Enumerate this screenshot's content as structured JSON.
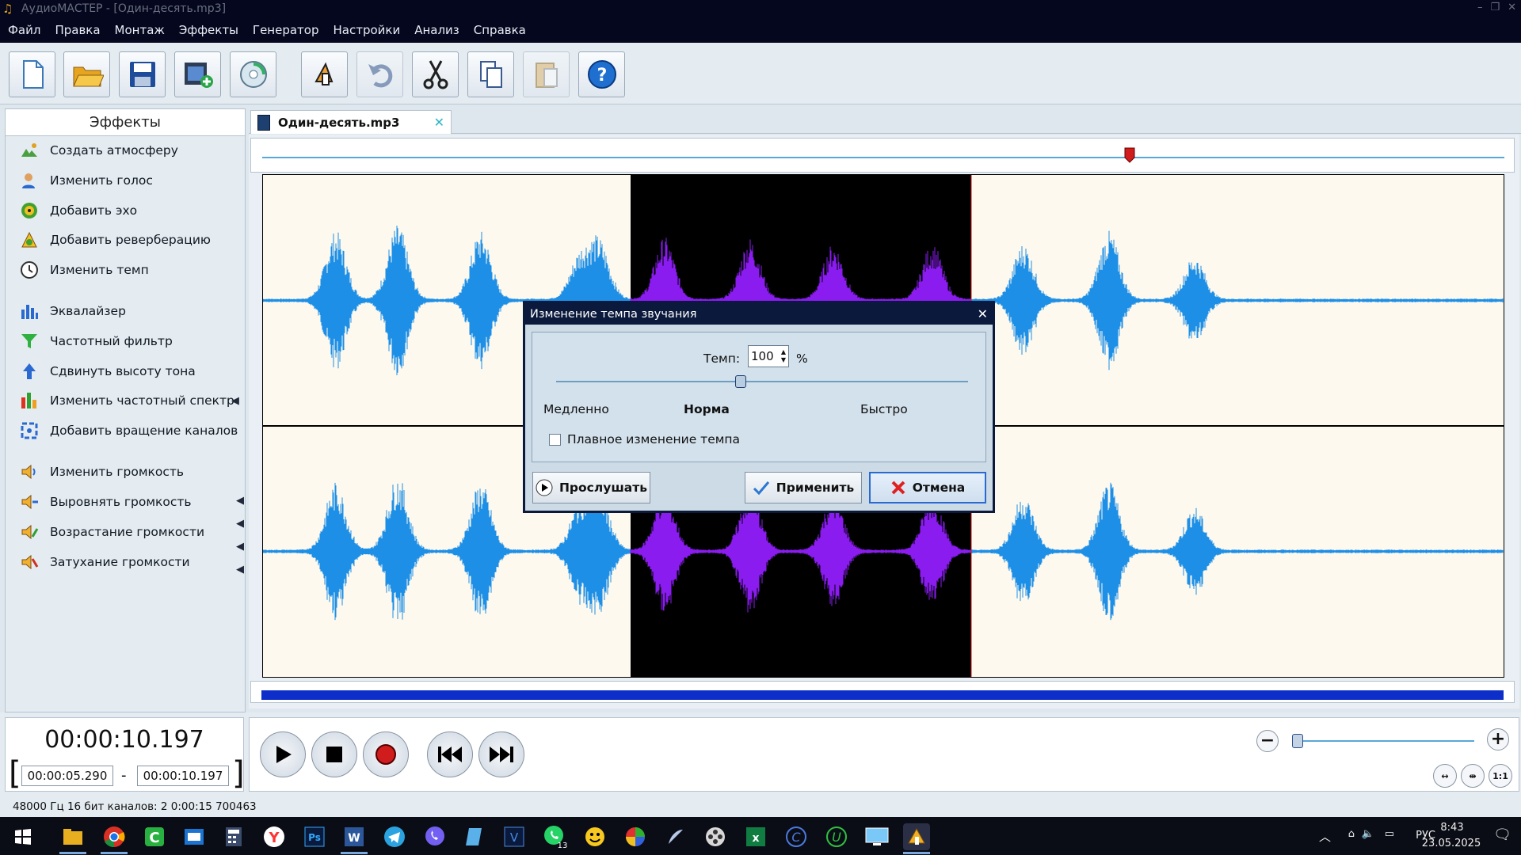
{
  "window": {
    "title": "АудиоМАСТЕР - [Один-десять.mp3]"
  },
  "menu": [
    "Файл",
    "Правка",
    "Монтаж",
    "Эффекты",
    "Генератор",
    "Настройки",
    "Анализ",
    "Справка"
  ],
  "toolbar": {
    "icons": [
      "new-file-icon",
      "open-folder-icon",
      "save-disk-icon",
      "add-video-icon",
      "cd-extract-icon",
      "voice-record-icon",
      "undo-icon",
      "scissors-icon",
      "copy-icon",
      "paste-icon",
      "help-icon"
    ]
  },
  "effects_panel": {
    "title": "Эффекты",
    "items": [
      {
        "label": "Создать атмосферу",
        "icon": "atmosphere-icon"
      },
      {
        "label": "Изменить голос",
        "icon": "voice-change-icon"
      },
      {
        "label": "Добавить эхо",
        "icon": "echo-icon"
      },
      {
        "label": "Добавить реверберацию",
        "icon": "reverb-icon"
      },
      {
        "label": "Изменить темп",
        "icon": "tempo-clock-icon"
      },
      {
        "label": "Эквалайзер",
        "icon": "equalizer-icon"
      },
      {
        "label": "Частотный фильтр",
        "icon": "frequency-filter-icon"
      },
      {
        "label": "Сдвинуть высоту тона",
        "icon": "pitch-shift-icon"
      },
      {
        "label": "Изменить частотный спектр",
        "icon": "spectrum-icon"
      },
      {
        "label": "Добавить вращение каналов",
        "icon": "channel-rotate-icon"
      },
      {
        "label": "Изменить громкость",
        "icon": "volume-icon"
      },
      {
        "label": "Выровнять громкость",
        "icon": "normalize-volume-icon"
      },
      {
        "label": "Возрастание громкости",
        "icon": "fade-in-icon"
      },
      {
        "label": "Затухание громкости",
        "icon": "fade-out-icon"
      }
    ]
  },
  "tab": {
    "label": "Один-десять.mp3"
  },
  "colors": {
    "waveform": "#1e8fe6",
    "selection_wave": "#8a1cf0",
    "selection_bg": "#000000",
    "accent": "#0d2ec9",
    "playhead": "#d01c1c"
  },
  "selection": {
    "start": "00:00:05.290",
    "end": "00:00:10.197"
  },
  "current_time": "00:00:10.197",
  "dialog": {
    "title": "Изменение темпа звучания",
    "tempo_label": "Темп:",
    "tempo_value": "100",
    "tempo_unit": "%",
    "slow": "Медленно",
    "normal": "Норма",
    "fast": "Быстро",
    "smooth_label": "Плавное изменение темпа",
    "smooth_checked": false,
    "listen": "Прослушать",
    "apply": "Применить",
    "cancel": "Отмена"
  },
  "status": {
    "text": "48000 Гц  16 бит  каналов: 2   0:00:15 700463"
  },
  "taskbar": {
    "whatsapp_badge": "13",
    "tray_lang": "РУС",
    "time": "8:43",
    "date": "23.05.2025"
  }
}
